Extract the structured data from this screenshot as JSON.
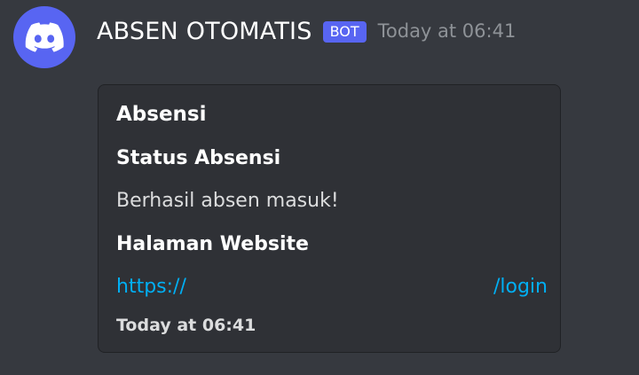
{
  "message": {
    "author": "ABSEN OTOMATIS",
    "bot_tag": "BOT",
    "timestamp": "Today at 06:41"
  },
  "embed": {
    "title": "Absensi",
    "fields": [
      {
        "name": "Status Absensi",
        "value": "Berhasil absen masuk!"
      },
      {
        "name": "Halaman Website"
      }
    ],
    "link_start": "https://",
    "link_end": "/login",
    "footer_timestamp": "Today at 06:41"
  },
  "icons": {
    "avatar": "discord-logo-icon"
  },
  "colors": {
    "background": "#36393f",
    "embed_background": "#2f3136",
    "accent": "#5865f2",
    "link": "#00aff4",
    "muted": "#8e9297"
  }
}
